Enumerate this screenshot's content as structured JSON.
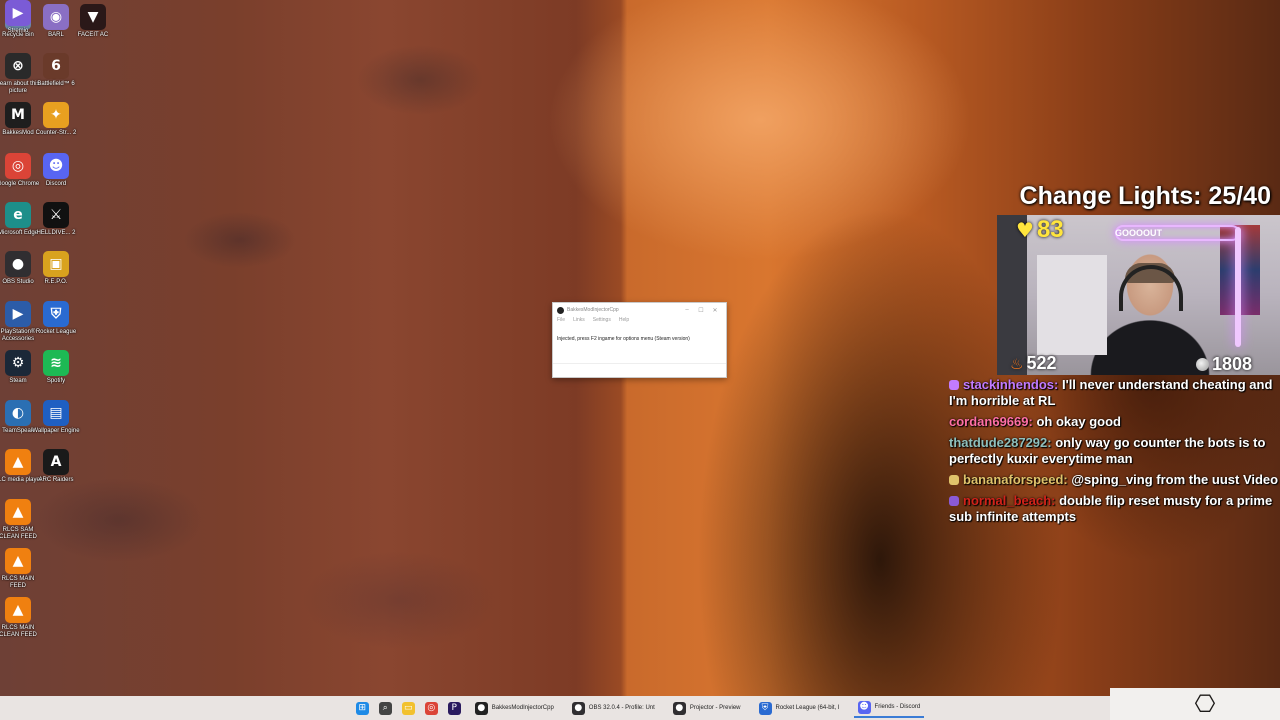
{
  "desktop": {
    "icons": [
      {
        "label": "Recycle Bin",
        "icon": "recycle-bin-icon",
        "color": "#6a86a8",
        "glyph": "♻"
      },
      {
        "label": "BARL",
        "icon": "barl-icon",
        "color": "#8a6fc4",
        "glyph": "◉"
      },
      {
        "label": "FACEIT AC",
        "icon": "faceit-icon",
        "color": "#2a1818",
        "glyph": "▼"
      },
      {
        "label": "Learn about this picture",
        "icon": "learn-picture-icon",
        "color": "#2a2a2a",
        "glyph": "⊗"
      },
      {
        "label": "Battlefield™ 6",
        "icon": "battlefield-icon",
        "color": "#6a3a2a",
        "glyph": "6"
      },
      {
        "label": "BakkesMod",
        "icon": "bakkesmod-icon",
        "color": "#1e1e1e",
        "glyph": "M"
      },
      {
        "label": "Counter-Str... 2",
        "icon": "counter-strike-icon",
        "color": "#e8a020",
        "glyph": "✦"
      },
      {
        "label": "Google Chrome",
        "icon": "chrome-icon",
        "color": "#db4437",
        "glyph": "◎"
      },
      {
        "label": "Discord",
        "icon": "discord-icon",
        "color": "#5865f2",
        "glyph": "☻"
      },
      {
        "label": "Microsoft Edge",
        "icon": "edge-icon",
        "color": "#1d8f8a",
        "glyph": "e"
      },
      {
        "label": "HELLDIVE... 2",
        "icon": "helldivers-icon",
        "color": "#111111",
        "glyph": "⚔"
      },
      {
        "label": "OBS Studio",
        "icon": "obs-icon",
        "color": "#302e31",
        "glyph": "●"
      },
      {
        "label": "R.E.P.O.",
        "icon": "repo-icon",
        "color": "#d9a21e",
        "glyph": "▣"
      },
      {
        "label": "PlayStation® Accessories",
        "icon": "playstation-icon",
        "color": "#2c5ca8",
        "glyph": "▶"
      },
      {
        "label": "Rocket League",
        "icon": "rocket-league-icon",
        "color": "#2a6ad1",
        "glyph": "⛨"
      },
      {
        "label": "Steam",
        "icon": "steam-icon",
        "color": "#1b2838",
        "glyph": "⚙"
      },
      {
        "label": "Spotify",
        "icon": "spotify-icon",
        "color": "#1db954",
        "glyph": "≋"
      },
      {
        "label": "TeamSpeak",
        "icon": "teamspeak-icon",
        "color": "#2b6fb3",
        "glyph": "◐"
      },
      {
        "label": "Wallpaper Engine",
        "icon": "wallpaper-engine-icon",
        "color": "#1f5fc2",
        "glyph": "▤"
      },
      {
        "label": "VLC media player",
        "icon": "vlc-icon",
        "color": "#f08010",
        "glyph": "▲"
      },
      {
        "label": "ARC Raiders",
        "icon": "arc-raiders-icon",
        "color": "#1a1a1a",
        "glyph": "A"
      },
      {
        "label": "RLCS SAM CLEAN FEED",
        "icon": "vlc-icon",
        "color": "#f08010",
        "glyph": "▲"
      },
      {
        "label": "RLCS MAIN FEED",
        "icon": "vlc-icon",
        "color": "#f08010",
        "glyph": "▲"
      },
      {
        "label": "RLCS MAIN CLEAN FEED",
        "icon": "vlc-icon",
        "color": "#f08010",
        "glyph": "▲"
      },
      {
        "label": "Stremio",
        "icon": "stremio-icon",
        "color": "#7b5bd6",
        "glyph": "▶"
      }
    ]
  },
  "dialog": {
    "title": "BakkesModInjectorCpp",
    "menu": [
      "File",
      "Links",
      "Settings",
      "Help"
    ],
    "message": "Injected, press F2 ingame for options menu (Steam version)"
  },
  "overlay": {
    "title": "Change Lights: 25/40",
    "hearts": "83",
    "fire": "522",
    "coins": "1808",
    "neon_text": "GOOOOUT",
    "colors": {
      "heart": "#ffe53d",
      "fire": "#ff7a1a"
    }
  },
  "chat": [
    {
      "user": "stackinhendos:",
      "text": "I'll never understand cheating and I'm horrible at RL",
      "cls": "u1",
      "badge": "#c27bff"
    },
    {
      "user": "cordan69669:",
      "text": "oh okay good",
      "cls": "u2",
      "badge": ""
    },
    {
      "user": "thatdude287292:",
      "text": "only way go counter the bots is to perfectly kuxir everytime man",
      "cls": "u3",
      "badge": ""
    },
    {
      "user": "bananaforspeed:",
      "text": "@sping_ving from the uust Video",
      "cls": "u4",
      "badge": "#e0c36b"
    },
    {
      "user": "normal_beach:",
      "text": "double flip reset musty for a prime sub infinite attempts",
      "cls": "u5",
      "badge": "#8a5ad6"
    }
  ],
  "taskbar": {
    "apps": [
      {
        "label": "BakkesModInjectorCpp",
        "icon": "bakkesmod-icon",
        "color": "#222222",
        "glyph": "●"
      },
      {
        "label": "OBS 32.0.4 - Profile: Unt",
        "icon": "obs-icon",
        "color": "#302e31",
        "glyph": "●"
      },
      {
        "label": "Projector - Preview",
        "icon": "obs-icon",
        "color": "#302e31",
        "glyph": "●"
      },
      {
        "label": "Rocket League (64-bit, I",
        "icon": "rocket-league-icon",
        "color": "#2a6ad1",
        "glyph": "⛨"
      },
      {
        "label": "Friends - Discord",
        "icon": "discord-icon",
        "color": "#5865f2",
        "glyph": "☻"
      }
    ],
    "pinned": [
      {
        "icon": "windows-start-icon",
        "color": "#1e8ae6",
        "glyph": "⊞"
      },
      {
        "icon": "search-icon",
        "color": "#444444",
        "glyph": "⌕"
      },
      {
        "icon": "file-explorer-icon",
        "color": "#f2c12e",
        "glyph": "▭"
      },
      {
        "icon": "chrome-icon",
        "color": "#db4437",
        "glyph": "◎"
      },
      {
        "icon": "premiere-icon",
        "color": "#2a1a5e",
        "glyph": "P"
      }
    ]
  },
  "tray": {
    "logo_icon": "gamers-logo-icon",
    "logo_glyph": "G"
  }
}
